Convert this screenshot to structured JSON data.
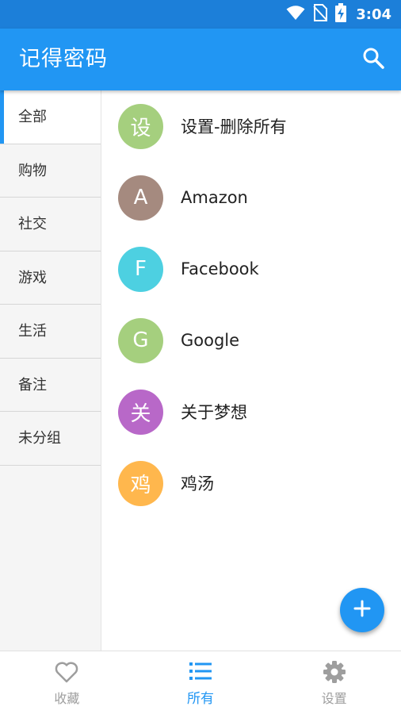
{
  "status_bar": {
    "time": "3:04",
    "icons": [
      "wifi-icon",
      "no-sim-icon",
      "battery-charging-icon"
    ],
    "color": "#1C7FD9"
  },
  "app_bar": {
    "title": "记得密码",
    "search_icon": "search-icon",
    "color": "#2196F3"
  },
  "sidebar": {
    "items": [
      {
        "label": "全部",
        "active": true
      },
      {
        "label": "购物",
        "active": false
      },
      {
        "label": "社交",
        "active": false
      },
      {
        "label": "游戏",
        "active": false
      },
      {
        "label": "生活",
        "active": false
      },
      {
        "label": "备注",
        "active": false
      },
      {
        "label": "未分组",
        "active": false
      }
    ]
  },
  "entries": [
    {
      "initial": "设",
      "label": "设置-删除所有",
      "color": "#A5CF7E"
    },
    {
      "initial": "A",
      "label": "Amazon",
      "color": "#A58A7F"
    },
    {
      "initial": "F",
      "label": "Facebook",
      "color": "#4DD0E1"
    },
    {
      "initial": "G",
      "label": "Google",
      "color": "#A5CF7E"
    },
    {
      "initial": "关",
      "label": "关于梦想",
      "color": "#B868C8"
    },
    {
      "initial": "鸡",
      "label": "鸡汤",
      "color": "#FFB74D"
    }
  ],
  "fab": {
    "icon": "plus-icon",
    "color": "#2196F3"
  },
  "bottom_nav": {
    "items": [
      {
        "label": "收藏",
        "icon": "heart-icon",
        "active": false
      },
      {
        "label": "所有",
        "icon": "list-icon",
        "active": true
      },
      {
        "label": "设置",
        "icon": "gear-icon",
        "active": false
      }
    ],
    "active_color": "#2196F3",
    "inactive_color": "#9E9E9E"
  }
}
